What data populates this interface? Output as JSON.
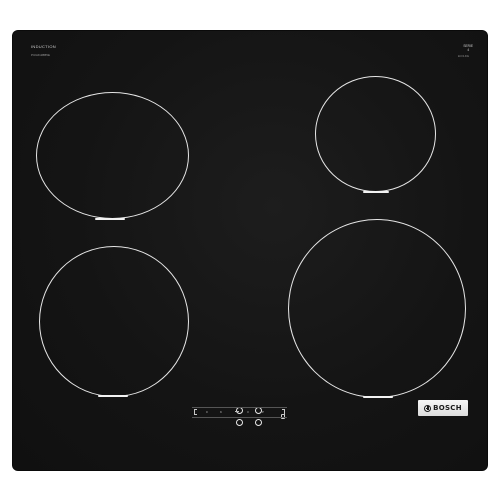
{
  "product": {
    "type_label": "INDUCTION",
    "model_label": "PUG611BB5E",
    "series_label_line1": "SERIE",
    "series_label_line2": "4",
    "series_sub": "ECOLINE",
    "brand": "BOSCH"
  },
  "zones": [
    {
      "name": "front-left"
    },
    {
      "name": "rear-left"
    },
    {
      "name": "rear-right"
    },
    {
      "name": "front-right"
    }
  ],
  "controls": {
    "strip_label_a": "0",
    "strip_label_b": "9",
    "strip_label_c": "3",
    "strip_label_d": "P"
  },
  "colors": {
    "glass": "#141414",
    "zone_outline": "#e6e6e6",
    "badge": "#e8e8e8"
  },
  "icons": {
    "zone_selector": "zone-selector-icon",
    "brand_logo": "bosch-logo-icon"
  }
}
